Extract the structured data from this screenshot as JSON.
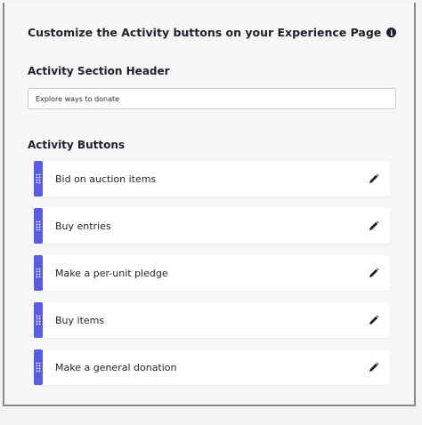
{
  "panel": {
    "title": "Customize the Activity buttons on your Experience Page",
    "info_icon": "info-icon",
    "header_section": {
      "label": "Activity Section Header",
      "value": "Explore ways to donate"
    },
    "buttons_section": {
      "label": "Activity Buttons",
      "items": [
        {
          "label": "Bid on auction items"
        },
        {
          "label": "Buy entries"
        },
        {
          "label": "Make a per-unit pledge"
        },
        {
          "label": "Buy items"
        },
        {
          "label": "Make a general donation"
        }
      ]
    }
  },
  "colors": {
    "accent": "#5a5ce0",
    "text": "#1f1f2e"
  },
  "icons": {
    "drag": "drag-handle-icon",
    "edit": "pencil-icon"
  }
}
